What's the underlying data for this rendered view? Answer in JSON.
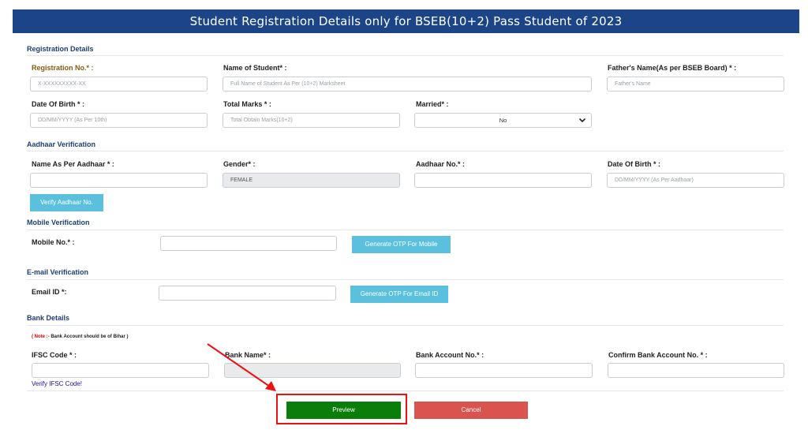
{
  "header": {
    "title": "Student Registration Details only for BSEB(10+2) Pass Student of 2023"
  },
  "registration": {
    "section_title": "Registration Details",
    "reg_no": {
      "label": "Registration No.* :",
      "placeholder": "X-XXXXXXXXX-XX"
    },
    "student_name": {
      "label": "Name of Student* :",
      "placeholder": "Full Name of Student As Per (10+2) Marksheet"
    },
    "father_name": {
      "label": "Father's Name(As per BSEB Board) * :",
      "placeholder": "Father's Name"
    },
    "dob": {
      "label": "Date Of Birth * :",
      "placeholder": "DD/MM/YYYY (As Per 10th)"
    },
    "total_marks": {
      "label": "Total Marks * :",
      "placeholder": "Total Obtain Marks(10+2)"
    },
    "married": {
      "label": "Married* :",
      "value": "No"
    }
  },
  "aadhaar": {
    "section_title": "Aadhaar Verification",
    "name": {
      "label": "Name As Per Aadhaar * :",
      "value": ""
    },
    "gender": {
      "label": "Gender* :",
      "value": "FEMALE"
    },
    "number": {
      "label": "Aadhaar No.* :",
      "value": ""
    },
    "dob": {
      "label": "Date Of Birth * :",
      "placeholder": "DD/MM/YYYY (As Per Aadhaar)"
    },
    "verify_button": "Verify Aadhaar No."
  },
  "mobile": {
    "section_title": "Mobile Verification",
    "label": "Mobile No.* :",
    "value": "",
    "otp_button": "Generate OTP For Mobile"
  },
  "email": {
    "section_title": "E-mail Verification",
    "label": "Email ID *:",
    "value": "",
    "otp_button": "Generate OTP For Email ID"
  },
  "bank": {
    "section_title": "Bank Details",
    "note_prefix": "( Note :- ",
    "note_text": "Bank Account should be of Bihar )",
    "ifsc": {
      "label": "IFSC Code * :",
      "value": ""
    },
    "bank_name": {
      "label": "Bank Name* :",
      "value": ""
    },
    "account_no": {
      "label": "Bank Account No.* :",
      "value": ""
    },
    "confirm_account_no": {
      "label": "Confirm Bank Account No. * :",
      "value": ""
    },
    "verify_ifsc_link": "Verify IFSC Code!"
  },
  "actions": {
    "preview": "Preview",
    "cancel": "Cancel"
  },
  "colors": {
    "banner": "#1c4587",
    "info_button": "#5bc0de",
    "preview_button": "#0a7e0a",
    "cancel_button": "#d9534f",
    "annotation": "#ee1111"
  }
}
